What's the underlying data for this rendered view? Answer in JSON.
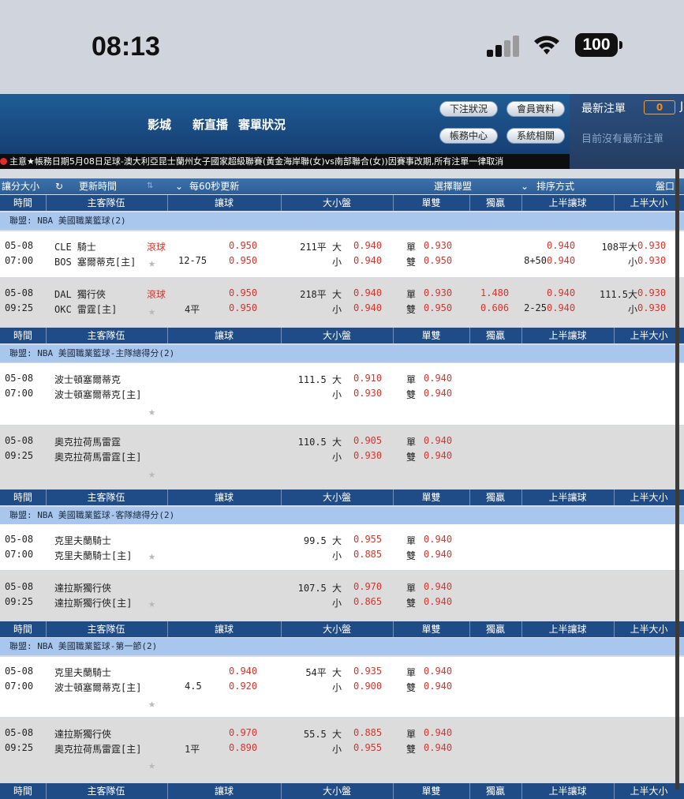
{
  "status_bar": {
    "time": "08:13",
    "battery": "100"
  },
  "header": {
    "links": [
      "影城",
      "新直播",
      "審單狀況"
    ],
    "buttons": [
      "下注狀況",
      "會員資料",
      "帳務中心",
      "系統相關"
    ]
  },
  "right_panel": {
    "title": "最新注單",
    "count": "0",
    "message": "目前沒有最新注單",
    "edge": "J"
  },
  "marquee": "主意★帳務日期5月08日足球-澳大利亞昆士蘭州女子國家超級聯賽(黃金海岸聯(女)vs南部聯合(女))因賽事改期,所有注單一律取消",
  "toolbar": {
    "size": "讓分大小",
    "refresh": "更新時間",
    "refresh_icon": "refresh-icon",
    "interval": "每60秒更新",
    "league": "選擇聯盟",
    "sort": "排序方式",
    "market": "盤口"
  },
  "columns": [
    "時間",
    "主客隊伍",
    "讓球",
    "大小盤",
    "單雙",
    "獨贏",
    "上半讓球",
    "上半大小"
  ],
  "leagues": [
    "聯盟: NBA 美國職業籃球(2)",
    "聯盟: NBA 美國職業籃球-主隊總得分(2)",
    "聯盟: NBA 美國職業籃球-客隊總得分(2)",
    "聯盟: NBA 美國職業籃球-第一節(2)"
  ],
  "matches": [
    {
      "date": "05-08",
      "time": "07:00",
      "team1": "CLE 騎士",
      "team2": "BOS 塞爾蒂克[主]",
      "live": "滾球",
      "hdp": "12-75",
      "hdp_o1": "0.950",
      "hdp_o2": "0.950",
      "ou_line": "211平 大",
      "ou_o1": "0.940",
      "ou_under": "小",
      "ou_o2": "0.940",
      "odd": "單",
      "odd_o": "0.930",
      "even": "雙",
      "even_o": "0.950",
      "ml1": "",
      "ml2": "",
      "h_line": "8+50",
      "h_o1": "0.940",
      "h_o2": "0.940",
      "hou_line": "108平大",
      "hou_o1": "0.930",
      "hou_under": "小",
      "hou_o2": "0.930"
    },
    {
      "date": "05-08",
      "time": "09:25",
      "team1": "DAL 獨行俠",
      "team2": "OKC 雷霆[主]",
      "live": "滾球",
      "hdp": "4平",
      "hdp_o1": "0.950",
      "hdp_o2": "0.950",
      "ou_line": "218平 大",
      "ou_o1": "0.940",
      "ou_under": "小",
      "ou_o2": "0.940",
      "odd": "單",
      "odd_o": "0.930",
      "even": "雙",
      "even_o": "0.950",
      "ml1": "1.480",
      "ml2": "0.606",
      "h_line": "2-25",
      "h_o1": "0.940",
      "h_o2": "0.940",
      "hou_line": "111.5大",
      "hou_o1": "0.930",
      "hou_under": "小",
      "hou_o2": "0.930"
    },
    {
      "date": "05-08",
      "time": "07:00",
      "team1": "波士頓塞爾蒂克",
      "team2": "波士頓塞爾蒂克[主]",
      "ou_line": "111.5 大",
      "ou_o1": "0.910",
      "ou_under": "小",
      "ou_o2": "0.930",
      "odd": "單",
      "odd_o": "0.940",
      "even": "雙",
      "even_o": "0.940"
    },
    {
      "date": "05-08",
      "time": "09:25",
      "team1": "奧克拉荷馬雷霆",
      "team2": "奧克拉荷馬雷霆[主]",
      "ou_line": "110.5 大",
      "ou_o1": "0.905",
      "ou_under": "小",
      "ou_o2": "0.930",
      "odd": "單",
      "odd_o": "0.940",
      "even": "雙",
      "even_o": "0.940"
    },
    {
      "date": "05-08",
      "time": "07:00",
      "team1": "克里夫蘭騎士",
      "team2": "克里夫蘭騎士[主]",
      "ou_line": "99.5 大",
      "ou_o1": "0.955",
      "ou_under": "小",
      "ou_o2": "0.885",
      "odd": "單",
      "odd_o": "0.940",
      "even": "雙",
      "even_o": "0.940"
    },
    {
      "date": "05-08",
      "time": "09:25",
      "team1": "達拉斯獨行俠",
      "team2": "達拉斯獨行俠[主]",
      "ou_line": "107.5 大",
      "ou_o1": "0.970",
      "ou_under": "小",
      "ou_o2": "0.865",
      "odd": "單",
      "odd_o": "0.940",
      "even": "雙",
      "even_o": "0.940"
    },
    {
      "date": "05-08",
      "time": "07:00",
      "team1": "克里夫蘭騎士",
      "team2": "波士頓塞爾蒂克[主]",
      "hdp": "4.5",
      "hdp_o1": "0.940",
      "hdp_o2": "0.920",
      "ou_line": "54平 大",
      "ou_o1": "0.935",
      "ou_under": "小",
      "ou_o2": "0.900",
      "odd": "單",
      "odd_o": "0.940",
      "even": "雙",
      "even_o": "0.940"
    },
    {
      "date": "05-08",
      "time": "09:25",
      "team1": "達拉斯獨行俠",
      "team2": "奧克拉荷馬雷霆[主]",
      "hdp": "1平",
      "hdp_o1": "0.970",
      "hdp_o2": "0.890",
      "ou_line": "55.5 大",
      "ou_o1": "0.885",
      "ou_under": "小",
      "ou_o2": "0.955",
      "odd": "單",
      "odd_o": "0.940",
      "even": "雙",
      "even_o": "0.940"
    }
  ],
  "colors": {
    "header": "#1f5d96",
    "column_header": "#1f4b86",
    "league_row": "#a9c6ed",
    "odds": "#d8342c"
  }
}
